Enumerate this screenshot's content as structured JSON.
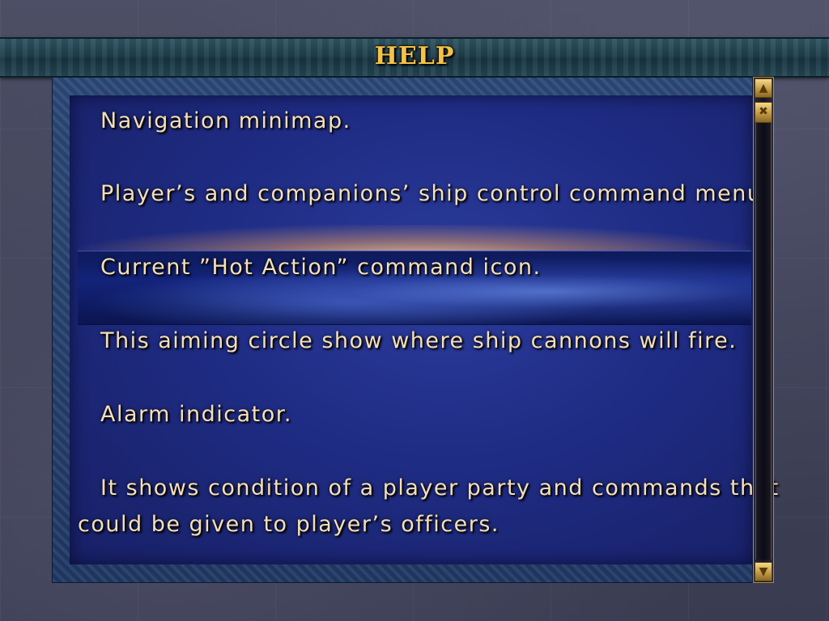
{
  "title": "HELP",
  "help_lines": [
    "Navigation minimap.",
    "Player’s and companions’ ship control command menu.",
    "Current ”Hot Action” command icon.",
    "This aiming circle show where ship cannons will fire.",
    "Alarm indicator.",
    "It shows condition of a player party and commands that",
    "could be given to player’s officers."
  ],
  "selected_line_index": 2,
  "scroll_position": 0.0,
  "icons": {
    "scroll_up": "chevron-up-icon",
    "scroll_thumb": "scroll-thumb-icon",
    "scroll_down": "chevron-down-icon"
  },
  "colors": {
    "title": "#f2c24a",
    "text": "#f5dfb8",
    "panel": "#1f2c84",
    "highlight": "#13237a",
    "scroll_gold": "#c9a04a"
  }
}
